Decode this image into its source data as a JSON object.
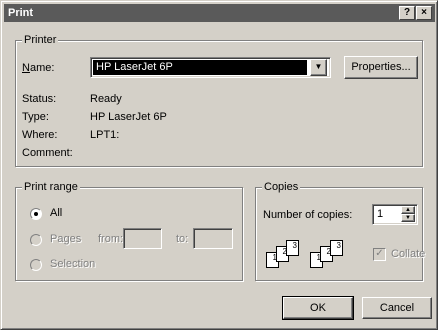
{
  "window": {
    "title": "Print",
    "help_label": "?",
    "close_label": "×"
  },
  "printer": {
    "group_label": "Printer",
    "name_label": "Name:",
    "name_value": "HP LaserJet 6P",
    "properties_label": "Properties...",
    "status_label": "Status:",
    "status_value": "Ready",
    "type_label": "Type:",
    "type_value": "HP LaserJet 6P",
    "where_label": "Where:",
    "where_value": "LPT1:",
    "comment_label": "Comment:",
    "comment_value": ""
  },
  "print_range": {
    "group_label": "Print range",
    "all_label": "All",
    "pages_label": "Pages",
    "from_label": "from:",
    "to_label": "to:",
    "from_value": "",
    "to_value": "",
    "selection_label": "Selection",
    "selected": "all"
  },
  "copies": {
    "group_label": "Copies",
    "number_label": "Number of copies:",
    "number_value": "1",
    "collate_label": "Collate",
    "collate_checked": true,
    "page_numbers": [
      "1",
      "2",
      "3"
    ]
  },
  "buttons": {
    "ok_label": "OK",
    "cancel_label": "Cancel"
  },
  "colors": {
    "dialog_face": "#d4d0c8",
    "title_bar": "#5a5a5a",
    "selection_highlight": "#000000"
  }
}
